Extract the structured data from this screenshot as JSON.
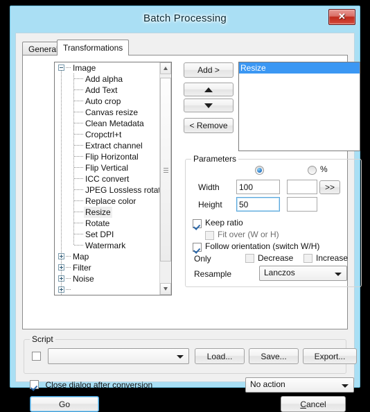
{
  "window": {
    "title": "Batch Processing",
    "close_label": "✕",
    "frame_color": "#aadff4",
    "accent_color": "#3b97f3"
  },
  "tabs": [
    {
      "id": "general",
      "label": "General",
      "active": false
    },
    {
      "id": "transformations",
      "label": "Transformations",
      "active": true
    }
  ],
  "tree": {
    "root": {
      "label": "Image",
      "expanded": true
    },
    "children": [
      "Add alpha",
      "Add Text",
      "Auto crop",
      "Canvas resize",
      "Clean Metadata",
      "Cropctrl+t",
      "Extract channel",
      "Flip Horizontal",
      "Flip Vertical",
      "ICC convert",
      "JPEG Lossless rotation",
      "Replace color",
      "Resize",
      "Rotate",
      "Set DPI",
      "Watermark"
    ],
    "selected_child": "Resize",
    "collapsed_groups": [
      "Map",
      "Filter",
      "Noise"
    ]
  },
  "transfer_buttons": {
    "add": "Add >",
    "move_up": "▲",
    "move_down": "▼",
    "remove": "< Remove"
  },
  "transform_list": {
    "items": [
      "Resize"
    ],
    "selected": "Resize"
  },
  "parameters": {
    "legend": "Parameters",
    "mode_absolute_selected": true,
    "percent_label": "%",
    "width_label": "Width",
    "width_value": "100",
    "width_percent_value": "",
    "height_label": "Height",
    "height_value": "50",
    "height_percent_value": "",
    "swap_button": ">>",
    "keep_ratio": {
      "label": "Keep ratio",
      "checked": true,
      "enabled": true
    },
    "fit_over": {
      "label": "Fit over (W or H)",
      "checked": false,
      "enabled": false
    },
    "follow_orientation": {
      "label": "Follow orientation (switch W/H)",
      "checked": true,
      "enabled": true
    },
    "only_label": "Only",
    "only_decrease": {
      "label": "Decrease",
      "checked": false
    },
    "only_increase": {
      "label": "Increase",
      "checked": false
    },
    "resample_label": "Resample",
    "resample_value": "Lanczos"
  },
  "script": {
    "legend": "Script",
    "enabled": false,
    "combo_value": "",
    "load_label": "Load...",
    "save_label": "Save...",
    "export_label": "Export..."
  },
  "footer": {
    "close_after_conversion": {
      "label": "Close dialog after conversion",
      "checked": true
    },
    "post_action_value": "No action",
    "go_label": "Go",
    "cancel_label": "Cancel"
  }
}
